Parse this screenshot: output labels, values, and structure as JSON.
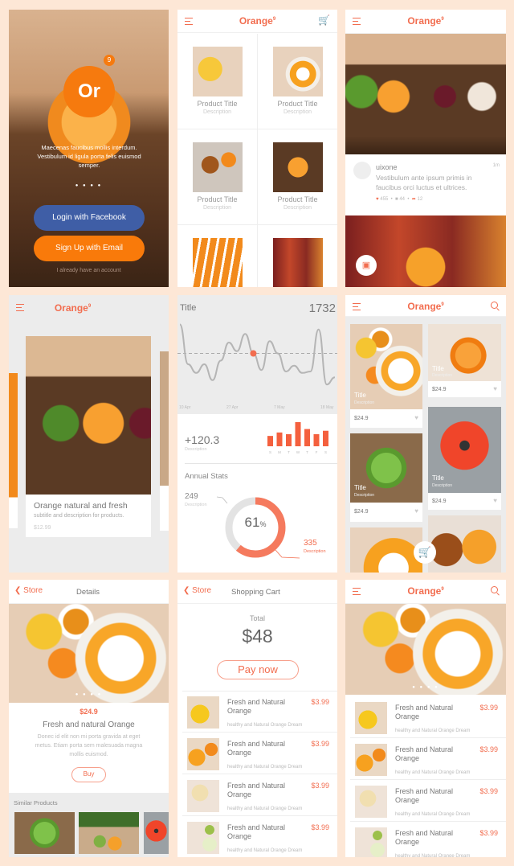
{
  "brand": {
    "name": "Orange",
    "sup": "9"
  },
  "colors": {
    "accent": "#f26d4f",
    "facebook": "#3f5ea6",
    "email": "#f97a0a",
    "background": "#fde7d6"
  },
  "login": {
    "logo": "Or",
    "badge": "9",
    "tagline": "Maecenas faucibus mollis interdum. Vestibulum id ligula porta felis euismod semper.",
    "facebook": "Login with Facebook",
    "email": "Sign Up with Email",
    "account": "I already have an account",
    "dots": "● ● ● ●"
  },
  "grid": {
    "items": [
      {
        "title": "Product Title",
        "desc": "Description"
      },
      {
        "title": "Product Title",
        "desc": "Description"
      },
      {
        "title": "Product Title",
        "desc": "Description"
      },
      {
        "title": "Product Title",
        "desc": "Description"
      }
    ]
  },
  "feed": {
    "user": "uixone",
    "time": "1m",
    "text": "Vestibulum ante ipsum primis in faucibus orci luctus et ultrices.",
    "likes": "455",
    "comments": "44",
    "shares": "12"
  },
  "card": {
    "title": "Orange natural and fresh",
    "subtitle": "subtitle and description for products.",
    "price": "$12.99"
  },
  "stats": {
    "title": "Title",
    "total": "1732",
    "x_ticks": [
      "10 Apr",
      "27 Apr",
      "7 May",
      "18 May"
    ],
    "line_values": [
      95,
      40,
      28,
      40,
      18,
      45,
      70,
      58,
      82,
      55,
      32,
      72,
      55,
      30,
      38,
      28,
      30,
      88,
      12,
      22
    ],
    "average": 55,
    "change": "+120.3",
    "change_desc": "Description",
    "bar_days": [
      "S",
      "M",
      "T",
      "W",
      "T",
      "F",
      "S"
    ],
    "bar_values": [
      3,
      4,
      3.5,
      7,
      5,
      3.5,
      4.5
    ],
    "annual": "Annual Stats",
    "left_value": "249",
    "left_desc": "Description",
    "percent": 61,
    "percent_text": "61",
    "percent_sign": "%",
    "right_value": "335",
    "right_desc": "Description"
  },
  "masonry": {
    "items": [
      {
        "title": "Title",
        "desc": "Description",
        "price": "$24.9"
      },
      {
        "title": "Title",
        "desc": "Description",
        "price": "$24.9"
      },
      {
        "title": "Title",
        "desc": "Description",
        "price": "$24.9"
      },
      {
        "title": "Title",
        "desc": "Description",
        "price": "$24.9"
      }
    ]
  },
  "details": {
    "back": "Store",
    "title": "Details",
    "price": "$24.9",
    "name": "Fresh and natural Orange",
    "desc": "Donec id elit non mi porta gravida at eget metus. Etiam porta sem malesuada magna mollis euismod.",
    "buy": "Buy",
    "similar": "Similar Products"
  },
  "cart": {
    "back": "Store",
    "title": "Shopping Cart",
    "total_label": "Total",
    "total": "$48",
    "pay": "Pay now"
  },
  "items": [
    {
      "name": "Fresh and Natural Orange",
      "sub": "healthy and Natural Orange Dream",
      "price": "$3.99"
    },
    {
      "name": "Fresh and Natural Orange",
      "sub": "healthy and Natural Orange Dream",
      "price": "$3.99"
    },
    {
      "name": "Fresh and Natural Orange",
      "sub": "healthy and Natural Orange Dream",
      "price": "$3.99"
    },
    {
      "name": "Fresh and Natural Orange",
      "sub": "healthy and Natural Orange Dream",
      "price": "$3.99"
    }
  ]
}
